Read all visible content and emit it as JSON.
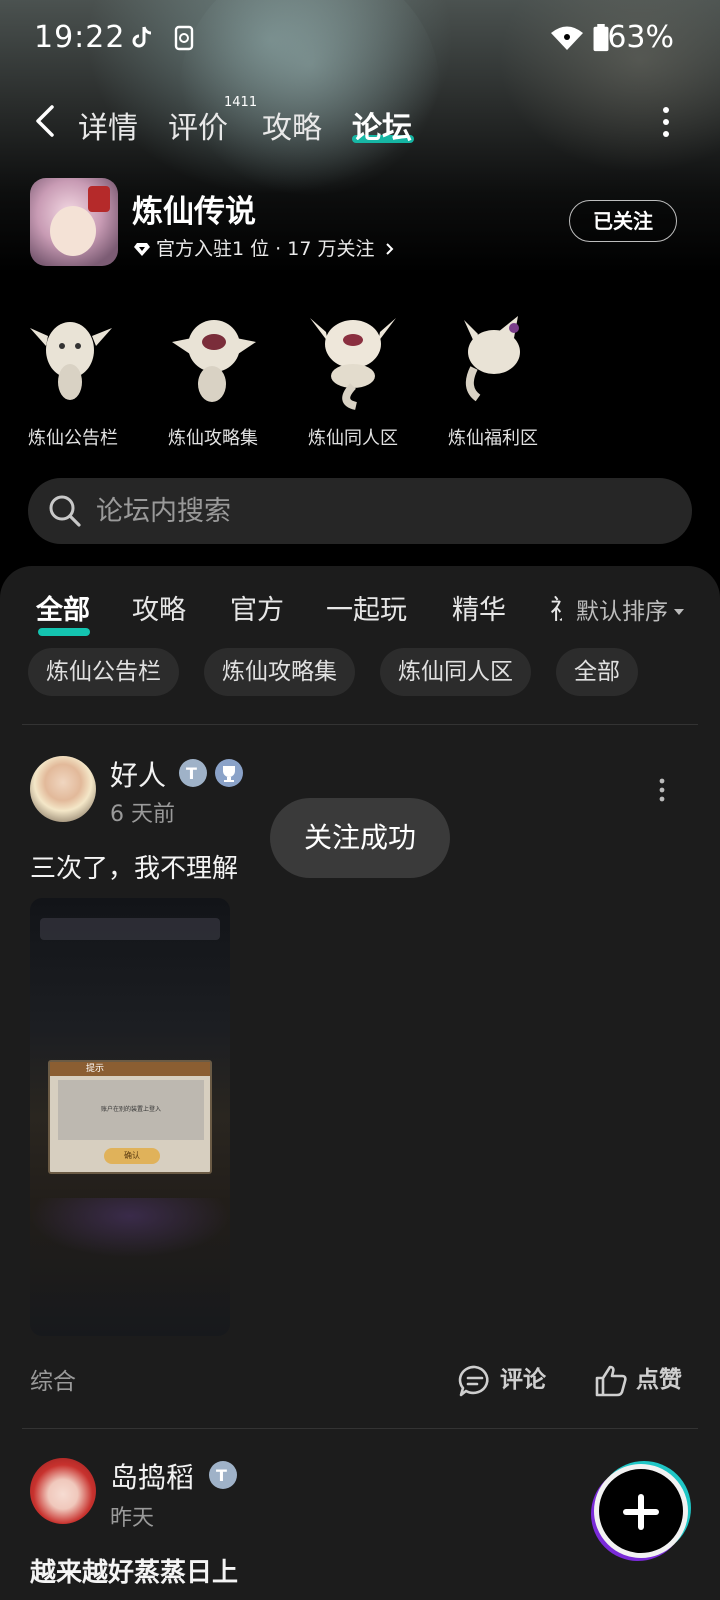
{
  "status_bar": {
    "time": "19:22",
    "battery": "63%"
  },
  "nav": {
    "tabs": [
      {
        "label": "详情"
      },
      {
        "label": "评价",
        "count": "1411"
      },
      {
        "label": "攻略"
      },
      {
        "label": "论坛"
      }
    ],
    "active_tab": "论坛"
  },
  "game": {
    "title": "炼仙传说",
    "meta": "官方入驻1 位 · 17 万关注",
    "follow_label": "已关注"
  },
  "boards": [
    {
      "label": "炼仙公告栏"
    },
    {
      "label": "炼仙攻略集"
    },
    {
      "label": "炼仙同人区"
    },
    {
      "label": "炼仙福利区"
    }
  ],
  "search": {
    "placeholder": "论坛内搜索"
  },
  "filter_tabs": [
    {
      "label": "全部"
    },
    {
      "label": "攻略"
    },
    {
      "label": "官方"
    },
    {
      "label": "一起玩"
    },
    {
      "label": "精华"
    },
    {
      "label": "视"
    }
  ],
  "sort_label": "默认排序",
  "chips": [
    {
      "label": "炼仙公告栏"
    },
    {
      "label": "炼仙攻略集"
    },
    {
      "label": "炼仙同人区"
    },
    {
      "label": "全部"
    }
  ],
  "posts": [
    {
      "author": "好人",
      "time": "6 天前",
      "text": "三次了，我不理解",
      "image_dialog": {
        "title": "提示",
        "message": "账户在别的装置上登入",
        "button": "确认"
      },
      "category": "综合",
      "comment_label": "评论",
      "like_label": "点赞"
    },
    {
      "author": "岛捣稻",
      "time": "昨天",
      "text": "越来越好蒸蒸日上"
    }
  ],
  "toast": "关注成功",
  "colors": {
    "accent": "#14c4b0",
    "panel": "#1c1c1c",
    "chip": "#2c2c2c"
  }
}
